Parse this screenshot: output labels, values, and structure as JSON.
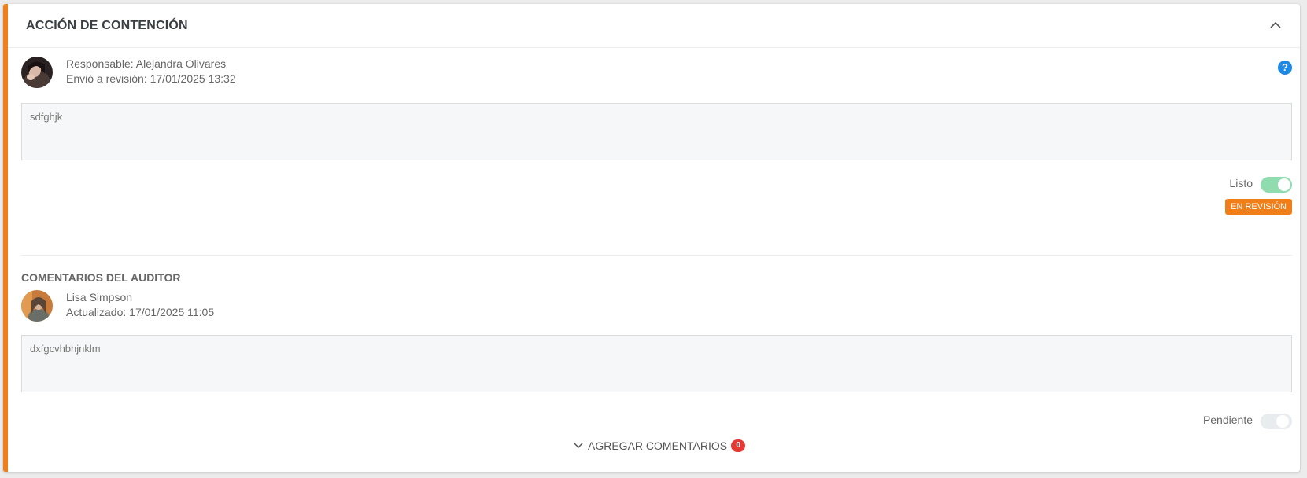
{
  "card": {
    "title": "ACCIÓN DE CONTENCIÓN",
    "collapse_icon": "chevron-up-icon",
    "help_icon": "?"
  },
  "response": {
    "responsible": "Responsable: Alejandra Olivares",
    "sent": "Envió a revisión: 17/01/2025 13:32",
    "text": "sdfghjk",
    "toggle_label": "Listo",
    "toggle_on": true,
    "status_badge": "EN REVISIÓN"
  },
  "auditor": {
    "section_title": "COMENTARIOS DEL AUDITOR",
    "name": "Lisa Simpson",
    "updated": "Actualizado: 17/01/2025 11:05",
    "text": "dxfgcvhbhjnklm",
    "toggle_label": "Pendiente",
    "toggle_on": false
  },
  "comments": {
    "label": "AGREGAR COMENTARIOS",
    "count": "0"
  },
  "colors": {
    "accent": "#f07f1a",
    "toggle_on": "#8fdcae",
    "toggle_off": "#e9ecef",
    "help": "#1e88e5",
    "count_badge": "#e53935"
  }
}
